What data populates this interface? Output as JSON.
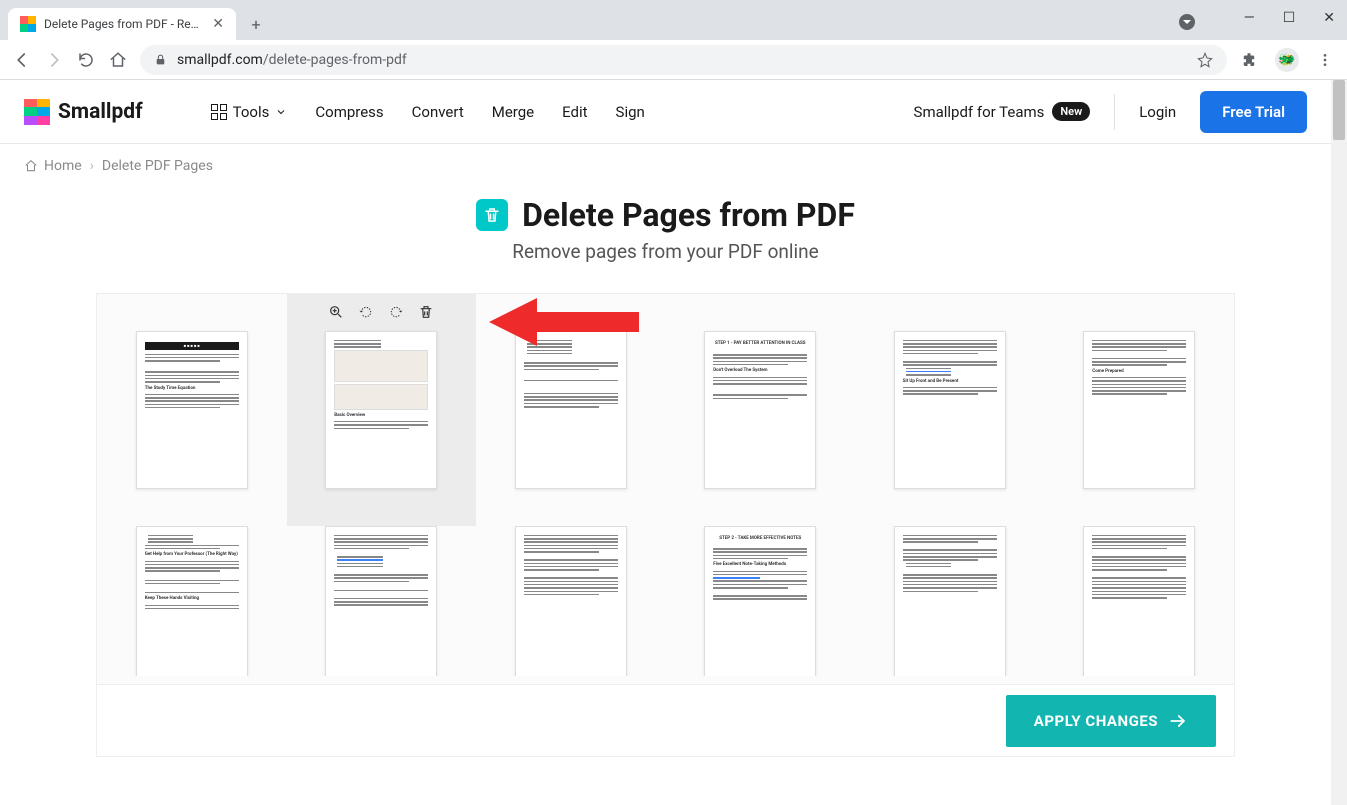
{
  "browser": {
    "tab_title": "Delete Pages from PDF - Remove",
    "url_domain": "smallpdf.com",
    "url_path": "/delete-pages-from-pdf"
  },
  "header": {
    "logo_text": "Smallpdf",
    "nav": {
      "tools": "Tools",
      "compress": "Compress",
      "convert": "Convert",
      "merge": "Merge",
      "edit": "Edit",
      "sign": "Sign"
    },
    "teams_label": "Smallpdf for Teams",
    "teams_badge": "New",
    "login": "Login",
    "trial": "Free Trial"
  },
  "breadcrumb": {
    "home": "Home",
    "current": "Delete PDF Pages"
  },
  "title": "Delete Pages from PDF",
  "subtitle": "Remove pages from your PDF online",
  "page_thumbs": {
    "p1_band": "■ ■ ■ ■ ■",
    "p1_h": "The Study Time Equation",
    "p2_h": "Basic Overview",
    "p4_h1": "STEP 1 - PAY BETTER ATTENTION IN CLASS",
    "p4_h2": "Don't Overload The System",
    "p5_h1": "Come Prepared",
    "p5_h2": "Sit Up Front and Be Present",
    "p7_h1": "Get Help from Your Professor (The Right Way)",
    "p7_h2": "Keep These Hands Visiting",
    "p10_h1": "STEP 2 - TAKE MORE EFFECTIVE NOTES",
    "p10_h2": "Five Excellent Note-Taking Methods"
  },
  "apply_label": "APPLY CHANGES"
}
